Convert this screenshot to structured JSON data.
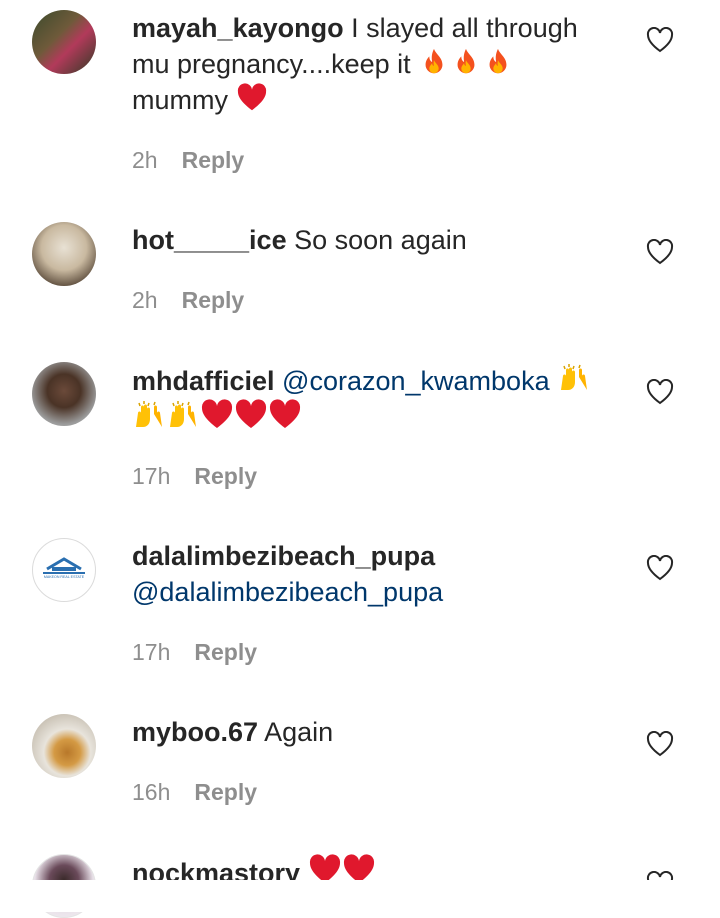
{
  "comments": [
    {
      "username": "mayah_kayongo",
      "line1": "I slayed all through",
      "line2": "mu pregnancy....keep it",
      "line3": "mummy",
      "time": "2h",
      "reply": "Reply"
    },
    {
      "username": "hot_____ice",
      "text": "So soon again",
      "time": "2h",
      "reply": "Reply"
    },
    {
      "username": "mhdafficiel",
      "mention": "@corazon_kwamboka",
      "time": "17h",
      "reply": "Reply"
    },
    {
      "username": "dalalimbezibeach_pupa",
      "mention": "@dalalimbezibeach_pupa",
      "time": "17h",
      "reply": "Reply",
      "avatar_text": "MAKEON REAL ESTATE"
    },
    {
      "username": "myboo.67",
      "text": "Again",
      "time": "16h",
      "reply": "Reply"
    },
    {
      "username": "nockmastory"
    }
  ],
  "icons": {
    "like": "heart-outline-icon",
    "fire": "fire-emoji",
    "heart": "red-heart-emoji",
    "raised_hands": "raising-hands-emoji"
  },
  "colors": {
    "text": "#262626",
    "mention": "#00376b",
    "meta": "#8e8e8e",
    "heart": "#e0182d"
  }
}
